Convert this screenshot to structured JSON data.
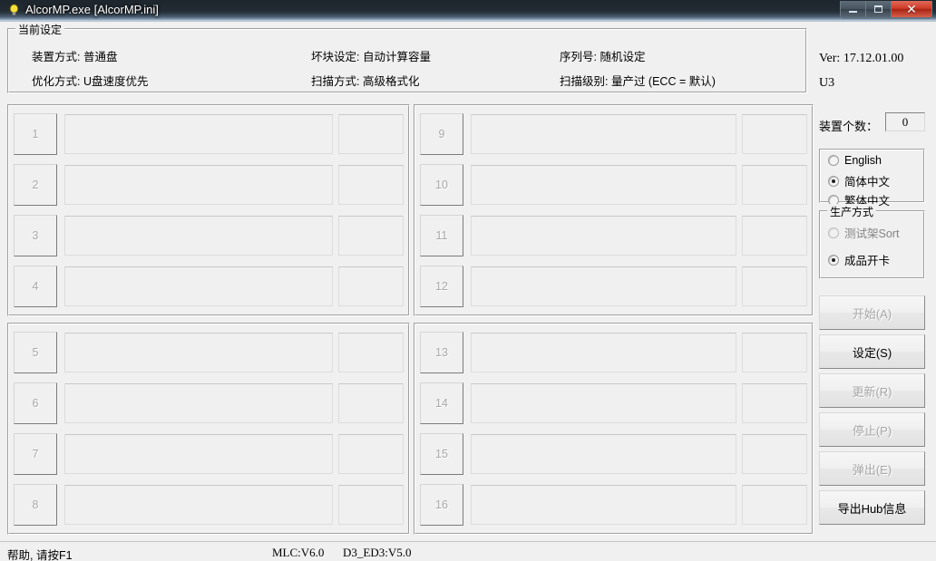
{
  "window": {
    "title": "AlcorMP.exe [AlcorMP.ini]",
    "icon": "bulb-icon",
    "minimize_label": "",
    "maximize_label": "",
    "close_label": "✕",
    "titlebar_color": "#222b33",
    "close_color": "#cf3c28"
  },
  "settings": {
    "group_title": "当前设定",
    "rows": [
      {
        "col1": "装置方式: 普通盘",
        "col2": "坏块设定: 自动计算容量",
        "col3": "序列号: 随机设定"
      },
      {
        "col1": "优化方式: U盘速度优先",
        "col2": "扫描方式: 高级格式化",
        "col3": "扫描级别: 量产过 (ECC = 默认)"
      }
    ]
  },
  "slots": {
    "panels": [
      {
        "name": "panel-top-left",
        "numbers": [
          "1",
          "2",
          "3",
          "4"
        ]
      },
      {
        "name": "panel-top-right",
        "numbers": [
          "9",
          "10",
          "11",
          "12"
        ]
      },
      {
        "name": "panel-bottom-left",
        "numbers": [
          "5",
          "6",
          "7",
          "8"
        ]
      },
      {
        "name": "panel-bottom-right",
        "numbers": [
          "13",
          "14",
          "15",
          "16"
        ]
      }
    ],
    "main_value": "",
    "side_value": ""
  },
  "right_panel": {
    "version": "Ver: 17.12.01.00",
    "mode": "U3",
    "device_count_label": "装置个数：",
    "device_count_value": "0",
    "language": {
      "options": [
        {
          "label": "English",
          "checked": false,
          "disabled": false
        },
        {
          "label": "简体中文",
          "checked": true,
          "disabled": false
        },
        {
          "label": "繁体中文",
          "checked": false,
          "disabled": false
        }
      ]
    },
    "production": {
      "group_title": "生产方式",
      "options": [
        {
          "label": "测试架Sort",
          "checked": false,
          "disabled": true
        },
        {
          "label": "成品开卡",
          "checked": true,
          "disabled": false
        }
      ]
    },
    "buttons": [
      {
        "name": "start-button",
        "label": "开始(A)",
        "key": "A",
        "disabled": true
      },
      {
        "name": "setup-button",
        "label": "设定(S)",
        "key": "S",
        "disabled": false
      },
      {
        "name": "update-button",
        "label": "更新(R)",
        "key": "R",
        "disabled": true
      },
      {
        "name": "stop-button",
        "label": "停止(P)",
        "key": "P",
        "disabled": true
      },
      {
        "name": "eject-button",
        "label": "弹出(E)",
        "key": "E",
        "disabled": true
      },
      {
        "name": "export-hub-button",
        "label": "导出Hub信息",
        "key": "",
        "disabled": false
      }
    ]
  },
  "statusbar": {
    "help": "帮助, 请按F1",
    "mlc_version": "MLC:V6.0",
    "d3_version": "D3_ED3:V5.0"
  }
}
